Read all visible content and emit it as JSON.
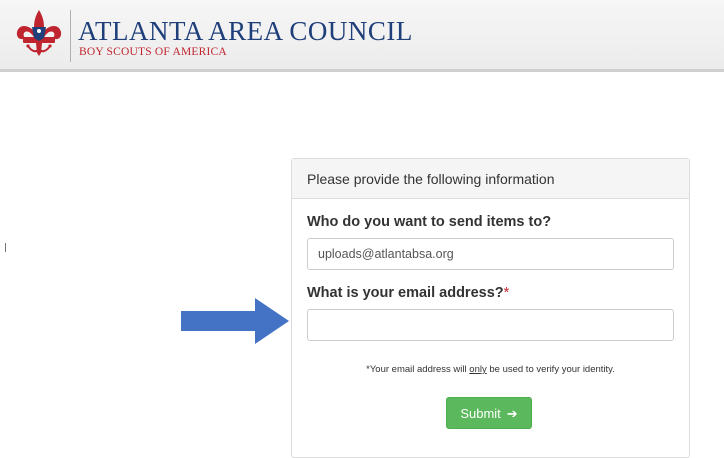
{
  "header": {
    "title": "ATLANTA AREA COUNCIL",
    "subtitle": "BOY SCOUTS OF AMERICA",
    "logo_icon": "bsa-fleur-de-lis-logo",
    "brand_colors": {
      "navy": "#1f3f7a",
      "red": "#c0252f"
    }
  },
  "form": {
    "heading": "Please provide the following information",
    "recipient_label": "Who do you want to send items to?",
    "recipient_value": "uploads@atlantabsa.org",
    "email_label": "What is your email address?",
    "required_marker": "*",
    "email_value": "",
    "note_prefix": "*Your email address will ",
    "note_emphasis": "only",
    "note_suffix": " be used to verify your identity.",
    "submit_label": "Submit",
    "submit_icon": "arrow-right-icon",
    "submit_color": "#5cb85c"
  },
  "annotation": {
    "pointer_icon": "blue-arrow-icon",
    "color": "#4472c4"
  }
}
